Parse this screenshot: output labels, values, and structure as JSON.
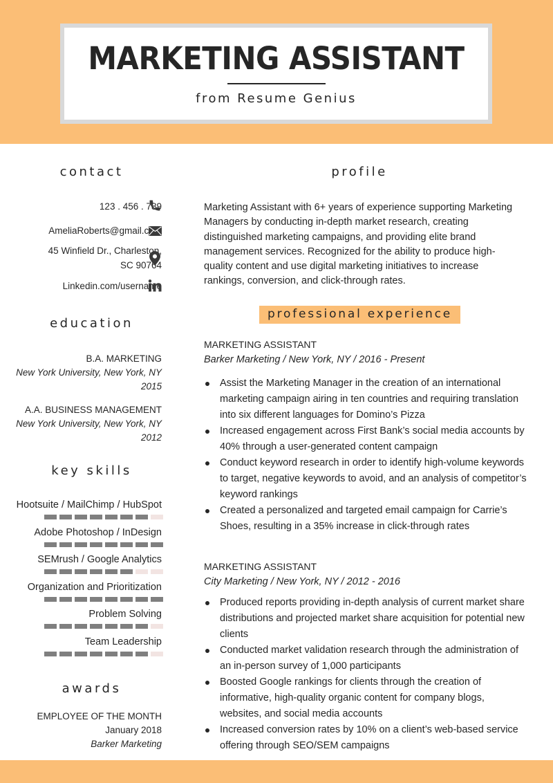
{
  "header": {
    "title": "MARKETING ASSISTANT",
    "subtitle": "from Resume Genius"
  },
  "colors": {
    "accent": "#fbbe76",
    "title_border": "#d9d9d9",
    "text": "#262626",
    "skill_filled": "#7f7f7f",
    "skill_empty": "#f2e4e2"
  },
  "contact": {
    "heading": "contact",
    "items": [
      {
        "icon": "phone-icon",
        "lines": [
          "123 . 456 . 789"
        ]
      },
      {
        "icon": "envelope-icon",
        "lines": [
          "AmeliaRoberts@gmail.com"
        ]
      },
      {
        "icon": "map-pin-icon",
        "lines": [
          "45 Winfield Dr., Charleston,",
          "SC 90764"
        ]
      },
      {
        "icon": "linkedin-icon",
        "lines": [
          "Linkedin.com/username"
        ]
      }
    ]
  },
  "education": {
    "heading": "education",
    "entries": [
      {
        "degree": "B.A. MARKETING",
        "school": "New York University, New York, NY",
        "year": "2015"
      },
      {
        "degree": "A.A. BUSINESS MANAGEMENT",
        "school": "New York University, New York, NY",
        "year": "2012"
      }
    ]
  },
  "skills": {
    "heading": "key skills",
    "max_level": 8,
    "items": [
      {
        "name": "Hootsuite / MailChimp / HubSpot",
        "level": 7
      },
      {
        "name": "Adobe Photoshop / InDesign",
        "level": 8
      },
      {
        "name": "SEMrush / Google Analytics",
        "level": 6
      },
      {
        "name": "Organization and Prioritization",
        "level": 8
      },
      {
        "name": "Problem Solving",
        "level": 7
      },
      {
        "name": "Team Leadership",
        "level": 7
      }
    ]
  },
  "awards": {
    "heading": "awards",
    "title": "EMPLOYEE OF THE MONTH",
    "date": "January 2018",
    "org": "Barker Marketing"
  },
  "profile": {
    "heading": "profile",
    "text": "Marketing Assistant with 6+ years of experience supporting Marketing Managers by conducting in-depth market research, creating distinguished marketing campaigns, and providing elite brand management services. Recognized for the ability to produce high-quality content and use digital marketing initiatives to increase rankings, conversion, and click-through rates."
  },
  "experience": {
    "heading": "professional experience",
    "jobs": [
      {
        "title": "MARKETING ASSISTANT",
        "subtitle": "Barker Marketing / New York, NY / 2016 - Present",
        "bullets": [
          "Assist the Marketing Manager in the creation of an international marketing campaign airing in ten countries and requiring translation into six different languages for Domino’s Pizza",
          "Increased engagement across First Bank’s social media accounts by 40% through a user-generated content campaign",
          "Conduct keyword research in order to identify high-volume keywords to target, negative keywords to avoid, and an analysis of competitor’s keyword rankings",
          "Created a personalized and targeted email campaign for Carrie’s Shoes, resulting in a 35% increase in click-through rates"
        ]
      },
      {
        "title": "MARKETING ASSISTANT",
        "subtitle": "City Marketing / New York, NY / 2012 - 2016",
        "bullets": [
          "Produced reports providing in-depth analysis of current market share distributions and projected market share acquisition for potential new clients",
          "Conducted market validation research through the administration of an in-person survey of 1,000 participants",
          "Boosted Google rankings for clients through the creation of informative, high-quality organic content for company blogs, websites, and social media accounts",
          "Increased conversion rates by 10% on a client’s web-based service offering through SEO/SEM campaigns"
        ]
      }
    ]
  }
}
